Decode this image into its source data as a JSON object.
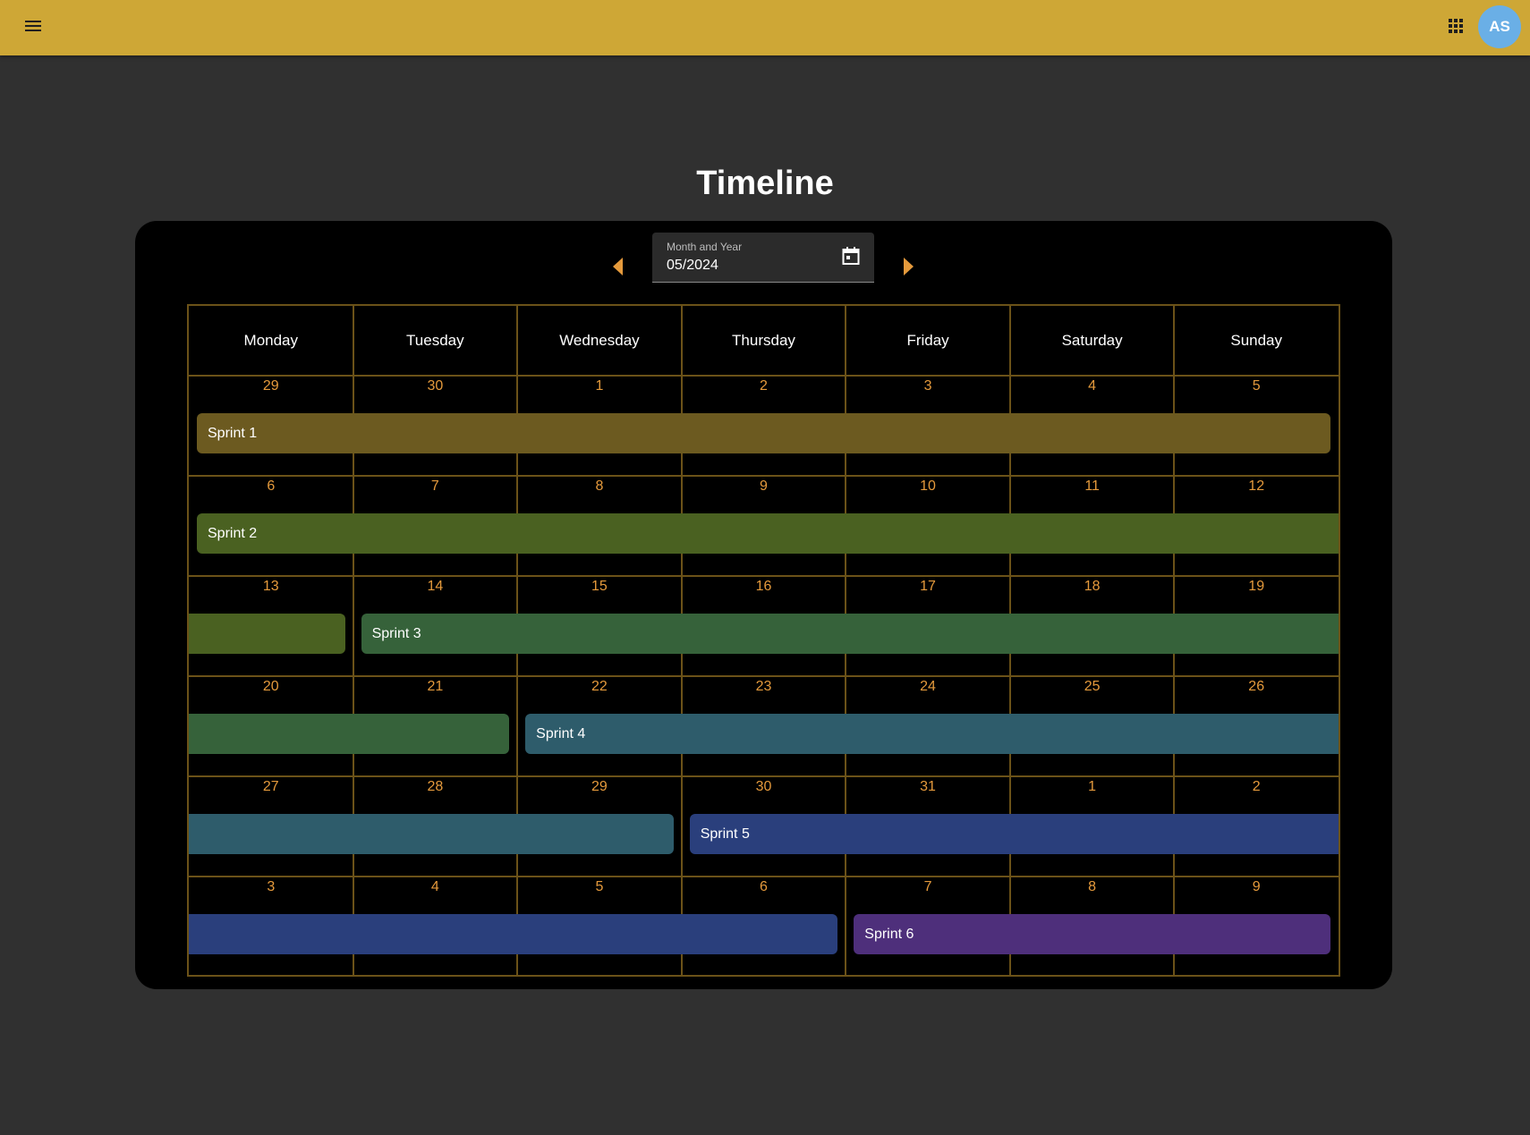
{
  "toolbar": {
    "menu_icon": "menu-icon",
    "apps_icon": "apps-grid-icon",
    "avatar_initials": "AS",
    "background": "#cea736"
  },
  "title": "Timeline",
  "month_picker": {
    "label": "Month and Year",
    "value": "05/2024",
    "calendar_icon": "calendar-icon",
    "prev_icon": "arrow-left-icon",
    "next_icon": "arrow-right-icon",
    "arrow_color": "#e59a3c"
  },
  "calendar": {
    "weekdays": [
      "Monday",
      "Tuesday",
      "Wednesday",
      "Thursday",
      "Friday",
      "Saturday",
      "Sunday"
    ],
    "weeks": [
      [
        "29",
        "30",
        "1",
        "2",
        "3",
        "4",
        "5"
      ],
      [
        "6",
        "7",
        "8",
        "9",
        "10",
        "11",
        "12"
      ],
      [
        "13",
        "14",
        "15",
        "16",
        "17",
        "18",
        "19"
      ],
      [
        "20",
        "21",
        "22",
        "23",
        "24",
        "25",
        "26"
      ],
      [
        "27",
        "28",
        "29",
        "30",
        "31",
        "1",
        "2"
      ],
      [
        "3",
        "4",
        "5",
        "6",
        "7",
        "8",
        "9"
      ]
    ],
    "grid_color": "#6b5218",
    "day_number_color": "#e59a3c"
  },
  "sprints": [
    {
      "name": "Sprint 1",
      "color": "#6c5a20",
      "segments": [
        {
          "week": 0,
          "start": 0,
          "end": 6,
          "label": true,
          "round_start": true,
          "round_end": true
        }
      ]
    },
    {
      "name": "Sprint 2",
      "color": "#4a6121",
      "segments": [
        {
          "week": 1,
          "start": 0,
          "end": 6,
          "label": true,
          "round_start": true,
          "round_end": false
        },
        {
          "week": 2,
          "start": 0,
          "end": 0,
          "label": false,
          "round_start": false,
          "round_end": true
        }
      ]
    },
    {
      "name": "Sprint 3",
      "color": "#36623a",
      "segments": [
        {
          "week": 2,
          "start": 1,
          "end": 6,
          "label": true,
          "round_start": true,
          "round_end": false
        },
        {
          "week": 3,
          "start": 0,
          "end": 1,
          "label": false,
          "round_start": false,
          "round_end": true
        }
      ]
    },
    {
      "name": "Sprint 4",
      "color": "#2e5c6b",
      "segments": [
        {
          "week": 3,
          "start": 2,
          "end": 6,
          "label": true,
          "round_start": true,
          "round_end": false
        },
        {
          "week": 4,
          "start": 0,
          "end": 2,
          "label": false,
          "round_start": false,
          "round_end": true
        }
      ]
    },
    {
      "name": "Sprint 5",
      "color": "#2a3f7c",
      "segments": [
        {
          "week": 4,
          "start": 3,
          "end": 6,
          "label": true,
          "round_start": true,
          "round_end": false
        },
        {
          "week": 5,
          "start": 0,
          "end": 3,
          "label": false,
          "round_start": false,
          "round_end": true
        }
      ]
    },
    {
      "name": "Sprint 6",
      "color": "#4e2f7b",
      "segments": [
        {
          "week": 5,
          "start": 4,
          "end": 6,
          "label": true,
          "round_start": true,
          "round_end": true
        }
      ]
    }
  ]
}
